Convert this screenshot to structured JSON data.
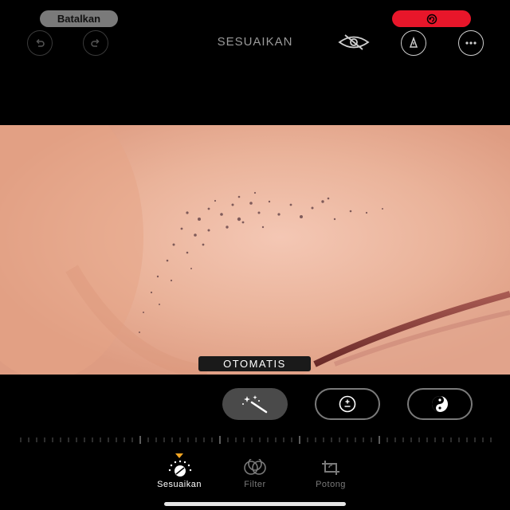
{
  "top_bar": {
    "cancel_label": "Batalkan",
    "title": "SESUAIKAN",
    "revert_color": "#e8162a",
    "icons": [
      "undo-icon",
      "redo-icon",
      "revert-icon",
      "hide-icon",
      "markup-icon",
      "more-icon"
    ]
  },
  "photo": {
    "badge_label": "OTOMATIS"
  },
  "tools": [
    {
      "name": "auto",
      "icon": "magic-wand-icon",
      "active": true
    },
    {
      "name": "exposure",
      "icon": "exposure-icon",
      "active": false
    },
    {
      "name": "brilliance",
      "icon": "brilliance-icon",
      "active": false
    }
  ],
  "tabs": [
    {
      "label": "Sesuaikan",
      "icon": "adjust-icon",
      "active": true
    },
    {
      "label": "Filter",
      "icon": "filter-icon",
      "active": false
    },
    {
      "label": "Potong",
      "icon": "crop-icon",
      "active": false
    }
  ],
  "accent_color": "#f5a623"
}
